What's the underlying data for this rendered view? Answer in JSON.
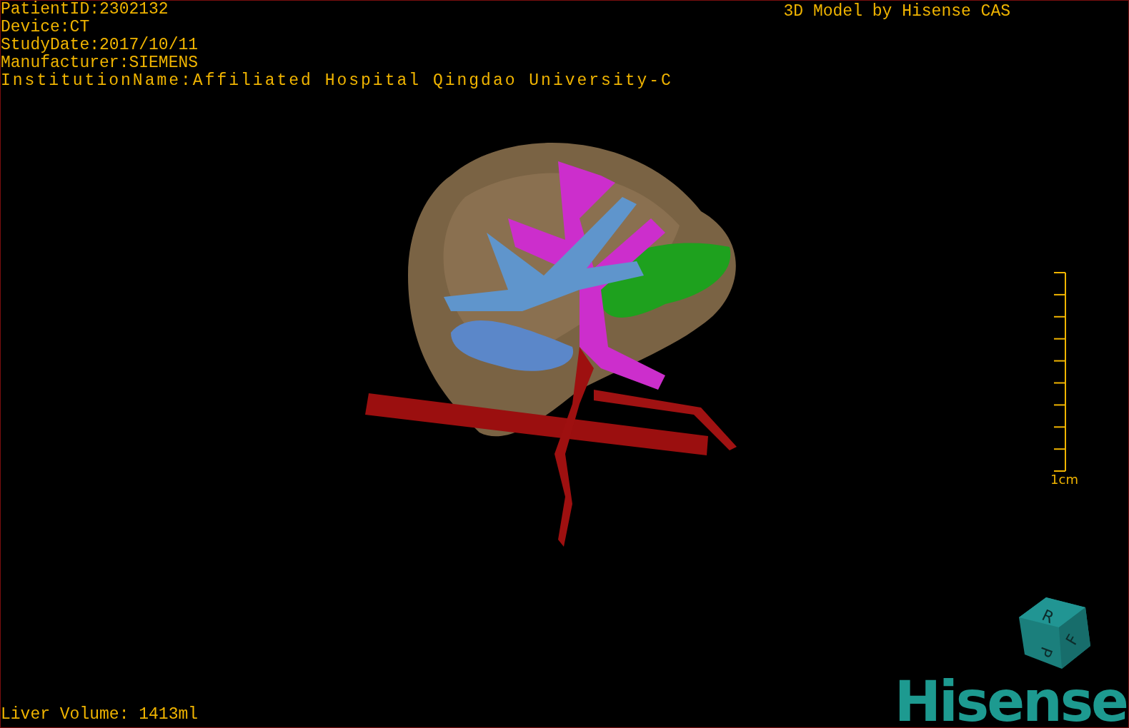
{
  "overlay_info": [
    "PatientID:2302132",
    "Device:CT",
    "StudyDate:2017/10/11",
    "Manufacturer:SIEMENS",
    "InstitutionName:Affiliated Hospital Qingdao University-C"
  ],
  "title": "3D Model by Hisense CAS",
  "scale_bar": {
    "label": "1cm"
  },
  "orientation_cube": {
    "faces": [
      "R",
      "F",
      "P"
    ]
  },
  "logo": "Hisense",
  "liver_volume": "Liver Volume: 1413ml"
}
